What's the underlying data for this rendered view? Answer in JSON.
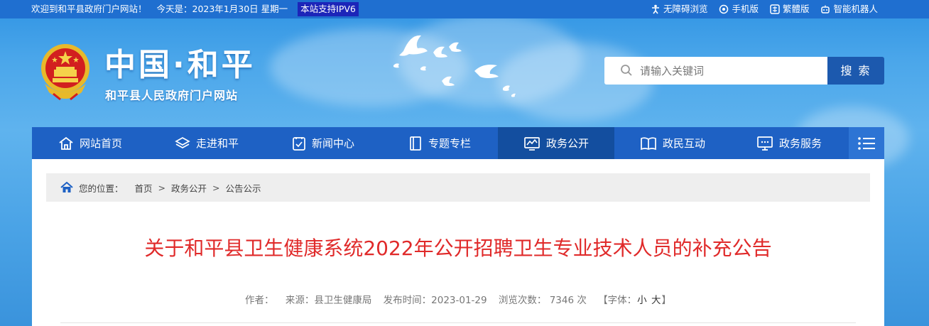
{
  "topbar": {
    "welcome": "欢迎到和平县政府门户网站！",
    "date": "今天是：2023年1月30日 星期一",
    "ipv6": "本站支持IPV6",
    "links": [
      "无障碍浏览",
      "手机版",
      "繁體版",
      "智能机器人"
    ]
  },
  "header": {
    "site_name": "中国·和平",
    "site_subtitle": "和平县人民政府门户网站"
  },
  "search": {
    "placeholder": "请输入关键词",
    "button": "搜 索"
  },
  "nav": {
    "items": [
      "网站首页",
      "走进和平",
      "新闻中心",
      "专题专栏",
      "政务公开",
      "政民互动",
      "政务服务"
    ],
    "active": "政务公开"
  },
  "breadcrumb": {
    "label": "您的位置：",
    "items": [
      "首页",
      "政务公开",
      "公告公示"
    ],
    "separator": ">"
  },
  "article": {
    "title": "关于和平县卫生健康系统2022年公开招聘卫生专业技术人员的补充公告",
    "author": "作者：",
    "source": "来源：县卫生健康局",
    "publish_time": "发布时间：2023-01-29",
    "views": "浏览次数： 7346 次",
    "font_label": "【字体：",
    "font_small": "小",
    "font_large": "大",
    "font_close": "】"
  },
  "colors": {
    "nav_bg": "#1e61c4",
    "nav_active": "#134e9f",
    "title_red": "#e02a2a",
    "search_button": "#1c59ae"
  }
}
